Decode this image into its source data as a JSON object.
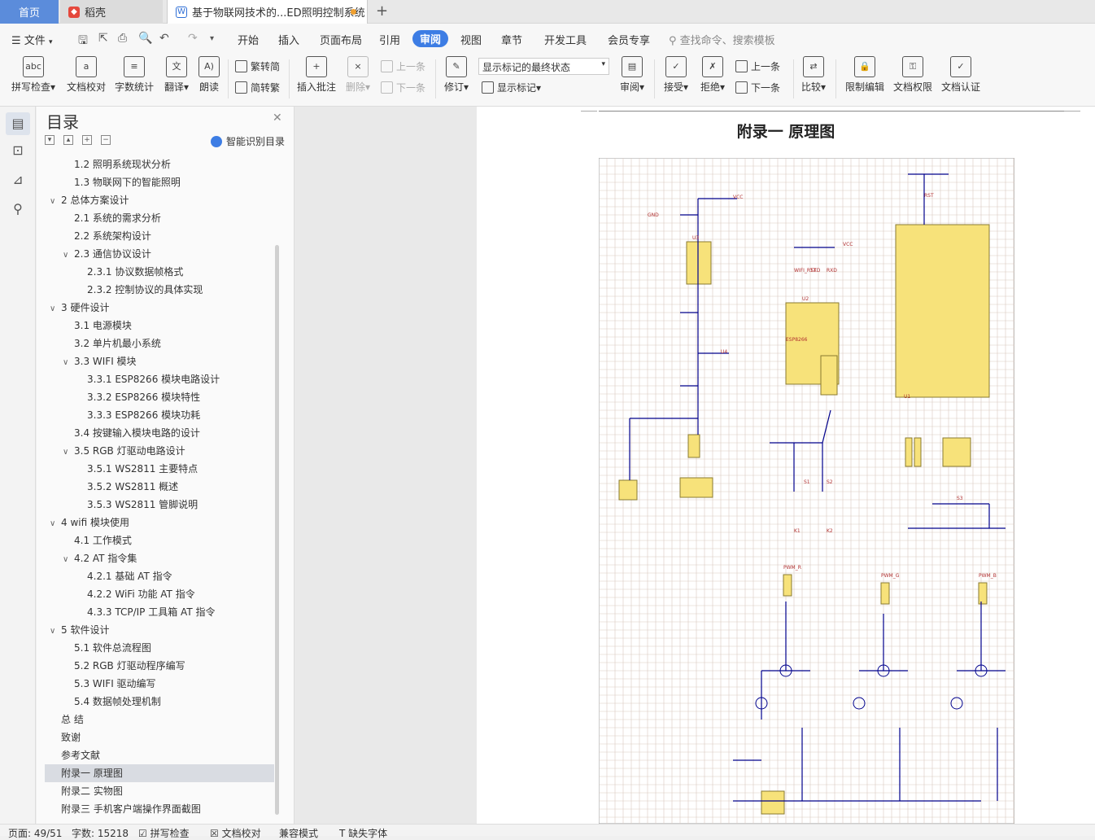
{
  "tabs": {
    "home": "首页",
    "daoke": "稻壳",
    "doc": "基于物联网技术的...ED照明控制系统"
  },
  "menu": {
    "file": "文件",
    "items": [
      "开始",
      "插入",
      "页面布局",
      "引用",
      "审阅",
      "视图",
      "章节",
      "开发工具",
      "会员专享"
    ],
    "search_placeholder": "查找命令、搜索模板"
  },
  "ribbon": {
    "spell_check": "拼写检查",
    "doc_check": "文档校对",
    "word_count": "字数统计",
    "translate": "翻译",
    "read_aloud": "朗读",
    "to_traditional": "繁转简",
    "to_simplified": "简转繁",
    "insert_comment": "插入批注",
    "delete": "删除",
    "prev": "上一条",
    "next": "下一条",
    "revise": "修订",
    "markup_state": "显示标记的最终状态",
    "show_markup": "显示标记",
    "review": "审阅",
    "accept": "接受",
    "reject": "拒绝",
    "prev2": "上一条",
    "next2": "下一条",
    "compare": "比较",
    "restrict_edit": "限制编辑",
    "doc_permission": "文档权限",
    "doc_cert": "文档认证"
  },
  "toc": {
    "title": "目录",
    "smart": "智能识别目录",
    "items": [
      {
        "t": "1.2  照明系统现状分析",
        "lvl": 1
      },
      {
        "t": "1.3  物联网下的智能照明",
        "lvl": 1
      },
      {
        "t": "2  总体方案设计",
        "lvl": 0,
        "arrow": "v"
      },
      {
        "t": "2.1  系统的需求分析",
        "lvl": 1
      },
      {
        "t": "2.2  系统架构设计",
        "lvl": 1
      },
      {
        "t": "2.3  通信协议设计",
        "lvl": 1,
        "arrow": "v"
      },
      {
        "t": "2.3.1 协议数据帧格式",
        "lvl": 2
      },
      {
        "t": "2.3.2 控制协议的具体实现",
        "lvl": 2
      },
      {
        "t": "3  硬件设计",
        "lvl": 0,
        "arrow": "v"
      },
      {
        "t": "3.1  电源模块",
        "lvl": 1
      },
      {
        "t": "3.2  单片机最小系统",
        "lvl": 1
      },
      {
        "t": "3.3 WIFI 模块",
        "lvl": 1,
        "arrow": "v"
      },
      {
        "t": "3.3.1 ESP8266 模块电路设计",
        "lvl": 2
      },
      {
        "t": "3.3.2 ESP8266 模块特性",
        "lvl": 2
      },
      {
        "t": "3.3.3 ESP8266 模块功耗",
        "lvl": 2
      },
      {
        "t": "3.4  按键输入模块电路的设计",
        "lvl": 1
      },
      {
        "t": "3.5 RGB  灯驱动电路设计",
        "lvl": 1,
        "arrow": "v"
      },
      {
        "t": "3.5.1 WS2811 主要特点",
        "lvl": 2
      },
      {
        "t": "3.5.2 WS2811 概述",
        "lvl": 2
      },
      {
        "t": "3.5.3 WS2811 管脚说明",
        "lvl": 2
      },
      {
        "t": "4 wifi 模块使用",
        "lvl": 0,
        "arrow": "v"
      },
      {
        "t": "4.1  工作模式",
        "lvl": 1
      },
      {
        "t": "4.2    AT 指令集",
        "lvl": 1,
        "arrow": "v"
      },
      {
        "t": "4.2.1  基础 AT 指令",
        "lvl": 2
      },
      {
        "t": "4.2.2 WiFi 功能 AT 指令",
        "lvl": 2
      },
      {
        "t": "4.3.3 TCP/IP 工具箱  AT 指令",
        "lvl": 2
      },
      {
        "t": "5  软件设计",
        "lvl": 0,
        "arrow": "v"
      },
      {
        "t": "5.1  软件总流程图",
        "lvl": 1
      },
      {
        "t": "5.2 RGB 灯驱动程序编写",
        "lvl": 1
      },
      {
        "t": "5.3 WIFI 驱动编写",
        "lvl": 1
      },
      {
        "t": "5.4  数据帧处理机制",
        "lvl": 1
      },
      {
        "t": "总  结",
        "lvl": 0
      },
      {
        "t": "致谢",
        "lvl": 0
      },
      {
        "t": "参考文献",
        "lvl": 0
      },
      {
        "t": "附录一  原理图",
        "lvl": 0,
        "selected": true
      },
      {
        "t": "附录二  实物图",
        "lvl": 0
      },
      {
        "t": "附录三  手机客户端操作界面截图",
        "lvl": 0
      }
    ]
  },
  "page": {
    "heading": "附录一  原理图"
  },
  "schematic": {
    "labels": [
      "VCC",
      "GND",
      "RST",
      "VCC",
      "RXD",
      "TXD",
      "WIFI_RST",
      "ESP8266",
      "PWM_R",
      "PWM_G",
      "PWM_B",
      "S1",
      "S2",
      "S3",
      "K1",
      "K2",
      "U1",
      "U2",
      "U3",
      "U4"
    ]
  },
  "status": {
    "page": "页面: 49/51",
    "words": "字数: 15218",
    "spell": "拼写检查",
    "doc_check": "文档校对",
    "compat": "兼容模式",
    "missing_font": "缺失字体"
  },
  "colors": {
    "accent": "#3d7de4",
    "home_tab": "#5b8cdb",
    "modified_dot": "#f0a030",
    "schematic_wire": "#00008b",
    "schematic_part": "#f7e27a",
    "schematic_label": "#b03030"
  }
}
